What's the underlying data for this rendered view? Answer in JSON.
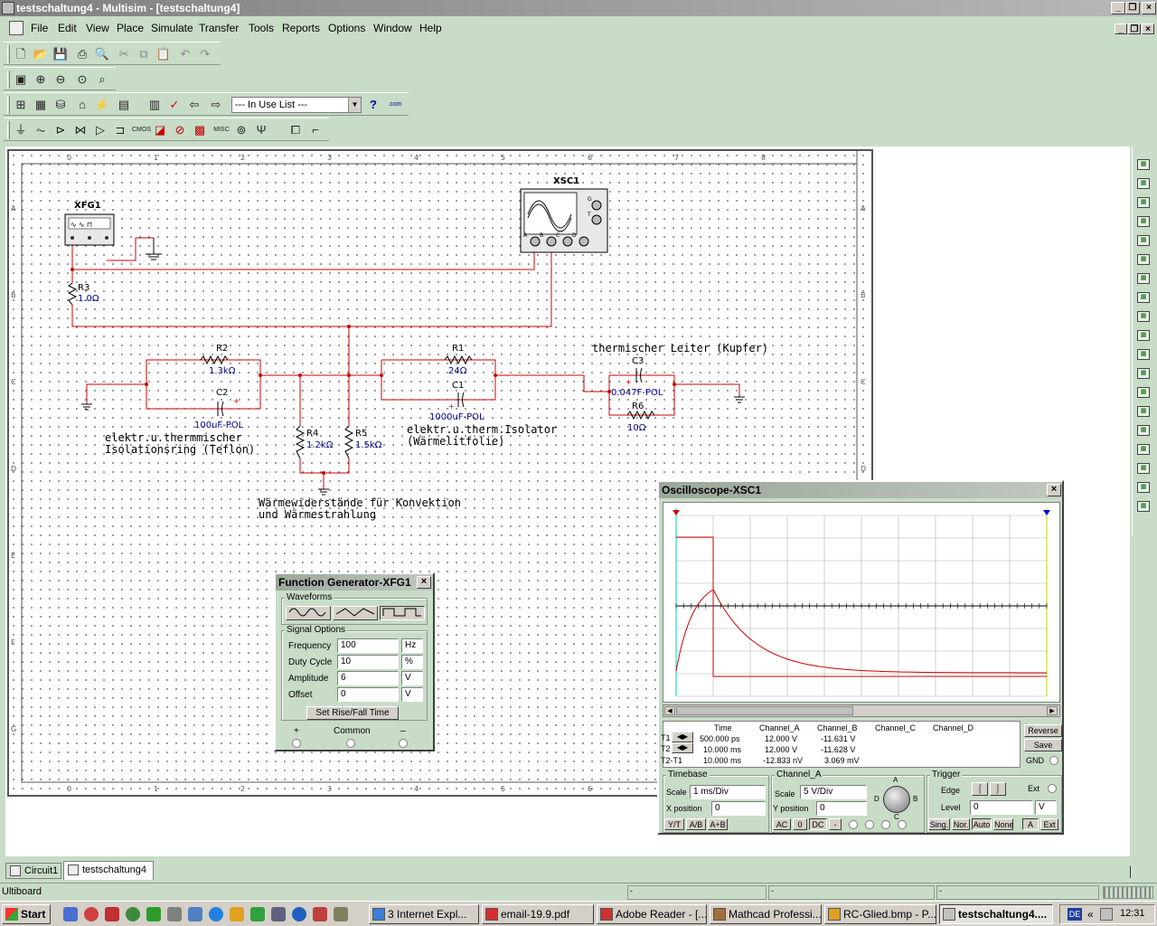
{
  "window": {
    "title": "testschaltung4 - Multisim - [testschaltung4]"
  },
  "menu": [
    "File",
    "Edit",
    "View",
    "Place",
    "Simulate",
    "Transfer",
    "Tools",
    "Reports",
    "Options",
    "Window",
    "Help"
  ],
  "toolbar": {
    "in_use_list": "--- In Use List ---",
    "com_label": ".com",
    "misc_label": "MISC"
  },
  "ruler": {
    "cols": [
      "0",
      "1",
      "2",
      "3",
      "4",
      "5",
      "6",
      "7",
      "8"
    ],
    "rows": [
      "A",
      "B",
      "C",
      "D",
      "E",
      "F",
      "G"
    ]
  },
  "schematic": {
    "xfg1": {
      "name": "XFG1"
    },
    "xsc1": {
      "name": "XSC1",
      "ports": [
        "A",
        "B",
        "C",
        "D"
      ],
      "side_ports": [
        "G",
        "T"
      ]
    },
    "r3": {
      "name": "R3",
      "value": "1.0Ω"
    },
    "r2": {
      "name": "R2",
      "value": "1.3kΩ"
    },
    "c2": {
      "name": "C2",
      "value": "100uF-POL"
    },
    "r1": {
      "name": "R1",
      "value": "24Ω"
    },
    "c1": {
      "name": "C1",
      "value": "1000uF-POL"
    },
    "c3": {
      "name": "C3",
      "value": "0.047F-POL"
    },
    "r6": {
      "name": "R6",
      "value": "10Ω"
    },
    "r4": {
      "name": "R4",
      "value": "1.2kΩ"
    },
    "r5": {
      "name": "R5",
      "value": "1.5kΩ"
    },
    "notes": {
      "teflon_1": "elektr.u.thermmischer",
      "teflon_2": "Isolationsring (Teflon)",
      "folie_1": "elektr.u.therm.Isolator",
      "folie_2": "(Wärmelitfolie)",
      "kupfer": "thermischer Leiter (Kupfer)",
      "konv_1": "Wärmewiderstände für Konvektion",
      "konv_2": "und Wärmestrahlung"
    }
  },
  "function_generator": {
    "title": "Function Generator-XFG1",
    "waveforms_label": "Waveforms",
    "signal_options_label": "Signal Options",
    "rows": [
      {
        "label": "Frequency",
        "value": "100",
        "unit": "Hz"
      },
      {
        "label": "Duty Cycle",
        "value": "10",
        "unit": "%"
      },
      {
        "label": "Amplitude",
        "value": "6",
        "unit": "V"
      },
      {
        "label": "Offset",
        "value": "0",
        "unit": "V"
      }
    ],
    "rise_fall_button": "Set Rise/Fall Time",
    "plus": "+",
    "common": "Common",
    "minus": "–"
  },
  "oscilloscope": {
    "title": "Oscilloscope-XSC1",
    "table_headers": [
      "Time",
      "Channel_A",
      "Channel_B",
      "Channel_C",
      "Channel_D"
    ],
    "t1": {
      "label": "T1",
      "time": "500.000 ps",
      "a": "12.000 V",
      "b": "-11.631 V"
    },
    "t2": {
      "label": "T2",
      "time": "10.000 ms",
      "a": "12.000 V",
      "b": "-11.628 V"
    },
    "t2t1": {
      "label": "T2-T1",
      "time": "10.000 ms",
      "a": "-12.833 nV",
      "b": "3.069 mV"
    },
    "reverse": "Reverse",
    "save": "Save",
    "gnd": "GND",
    "timebase": {
      "label": "Timebase",
      "scale_label": "Scale",
      "scale": "1 ms/Div",
      "xpos_label": "X position",
      "xpos": "0",
      "buttons": [
        "Y/T",
        "A/B",
        "A+B"
      ]
    },
    "channel_a": {
      "label": "Channel_A",
      "scale_label": "Scale",
      "scale": "5  V/Div",
      "ypos_label": "Y position",
      "ypos": "0",
      "buttons": [
        "AC",
        "0",
        "DC",
        "-"
      ]
    },
    "knob_labels": {
      "a": "A",
      "b": "B",
      "c": "C",
      "d": "D"
    },
    "trigger": {
      "label": "Trigger",
      "edge_label": "Edge",
      "level_label": "Level",
      "level": "0",
      "level_unit": "V",
      "ext": "Ext",
      "buttons": [
        "Sing.",
        "Nor.",
        "Auto",
        "None"
      ],
      "a": "A",
      "ext_btn": "Ext"
    },
    "colors": {
      "channel_a": "#cc0000",
      "cursor1": "#cc0000",
      "cursor2": "#0000cc",
      "grid": "#b0b0b0",
      "trace_black": "#000000"
    }
  },
  "tabs": [
    "Circuit1",
    "testschaltung4"
  ],
  "status": {
    "left": "Ultiboard",
    "cells": [
      "-",
      "-",
      "-"
    ]
  },
  "taskbar": {
    "start": "Start",
    "tasks": [
      "3 Internet Expl...",
      "email-19.9.pdf",
      "Adobe Reader - [...",
      "Mathcad Professi...",
      "RC-Glied.bmp - P...",
      "testschaltung4...."
    ],
    "lang": "DE",
    "time": "12:31"
  }
}
